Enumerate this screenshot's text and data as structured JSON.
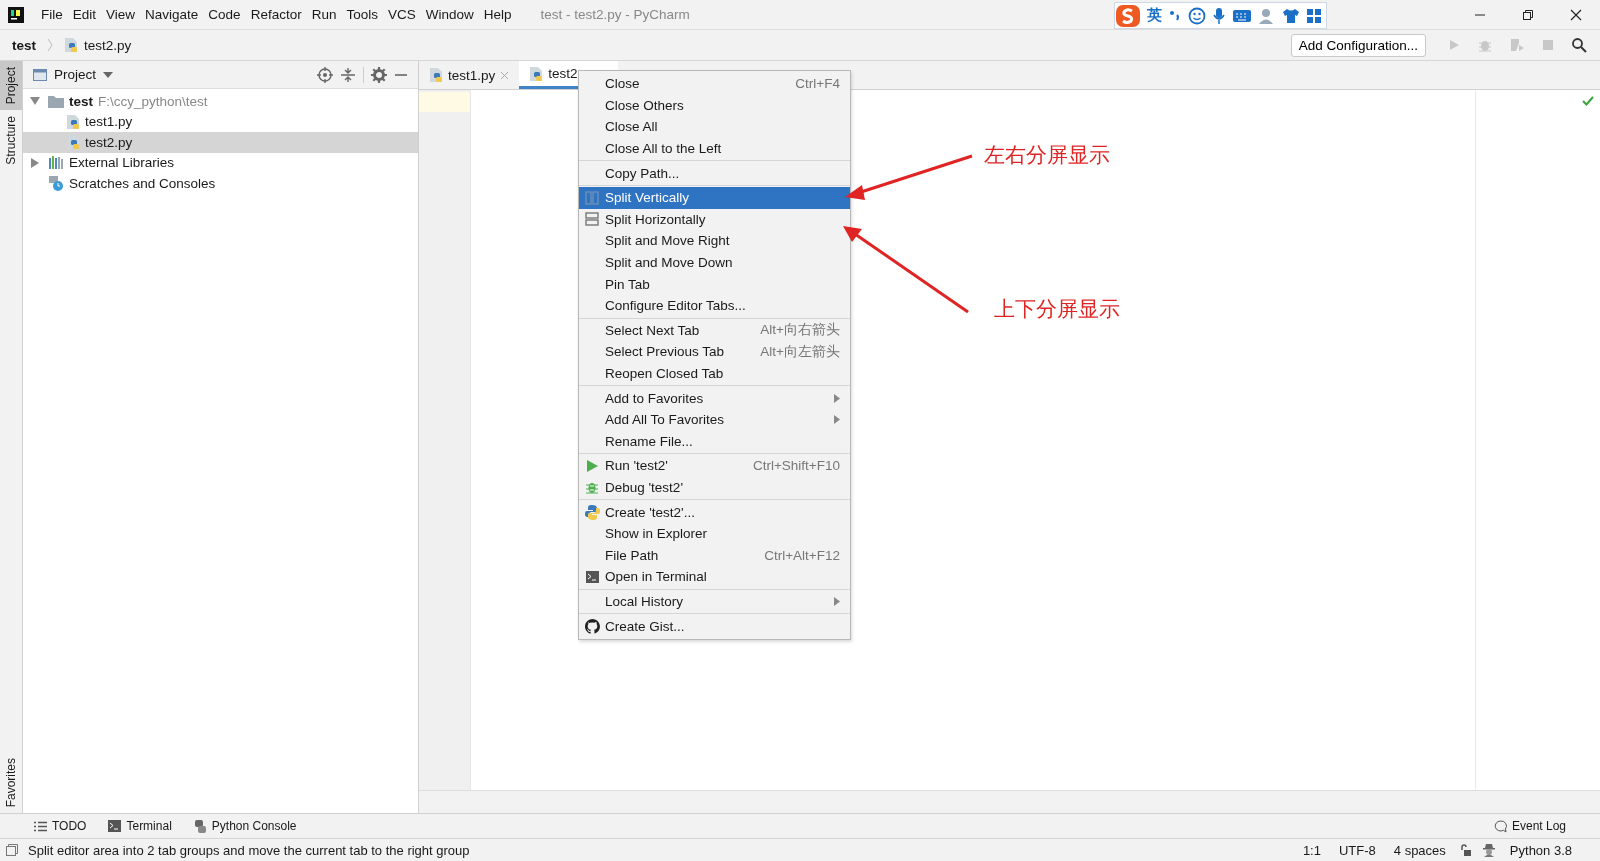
{
  "window": {
    "title": "test - test2.py - PyCharm"
  },
  "menu_bar": [
    "File",
    "Edit",
    "View",
    "Navigate",
    "Code",
    "Refactor",
    "Run",
    "Tools",
    "VCS",
    "Window",
    "Help"
  ],
  "ime_toolbar": {
    "label": "英"
  },
  "breadcrumbs": [
    "test",
    "test2.py"
  ],
  "toolbar": {
    "run_config": "Add Configuration..."
  },
  "side_strip": {
    "top": [
      {
        "label": "Project",
        "selected": true
      },
      {
        "label": "Structure",
        "selected": false
      }
    ],
    "bottom": [
      {
        "label": "Favorites",
        "selected": false
      }
    ]
  },
  "project_panel": {
    "title": "Project",
    "tree": [
      {
        "label": "test",
        "path": "F:\\ccy_python\\test",
        "expanded": true,
        "selected": false,
        "children": [
          {
            "label": "test1.py",
            "selected": false
          },
          {
            "label": "test2.py",
            "selected": true
          }
        ]
      },
      {
        "label": "External Libraries",
        "expanded": false,
        "selected": false
      },
      {
        "label": "Scratches and Consoles",
        "selected": false
      }
    ]
  },
  "editor_tabs": [
    {
      "label": "test1.py",
      "selected": false
    },
    {
      "label": "test2",
      "selected": true
    }
  ],
  "context_menu": {
    "groups": [
      [
        {
          "label": "Close",
          "shortcut": "Ctrl+F4",
          "selected": false
        },
        {
          "label": "Close Others",
          "selected": false
        },
        {
          "label": "Close All",
          "selected": false
        },
        {
          "label": "Close All to the Left",
          "selected": false
        }
      ],
      [
        {
          "label": "Copy Path...",
          "selected": false
        }
      ],
      [
        {
          "label": "Split Vertically",
          "selected": true
        },
        {
          "label": "Split Horizontally",
          "selected": false
        },
        {
          "label": "Split and Move Right",
          "selected": false
        },
        {
          "label": "Split and Move Down",
          "selected": false
        },
        {
          "label": "Pin Tab",
          "selected": false
        },
        {
          "label": "Configure Editor Tabs...",
          "selected": false
        }
      ],
      [
        {
          "label": "Select Next Tab",
          "shortcut": "Alt+向右箭头",
          "selected": false
        },
        {
          "label": "Select Previous Tab",
          "shortcut": "Alt+向左箭头",
          "selected": false
        },
        {
          "label": "Reopen Closed Tab",
          "selected": false
        }
      ],
      [
        {
          "label": "Add to Favorites",
          "submenu": true,
          "selected": false
        },
        {
          "label": "Add All To Favorites",
          "submenu": true,
          "selected": false
        },
        {
          "label": "Rename File...",
          "selected": false
        }
      ],
      [
        {
          "label": "Run 'test2'",
          "shortcut": "Ctrl+Shift+F10",
          "selected": false
        },
        {
          "label": "Debug 'test2'",
          "selected": false
        }
      ],
      [
        {
          "label": "Create 'test2'...",
          "selected": false
        },
        {
          "label": "Show in Explorer",
          "selected": false
        },
        {
          "label": "File Path",
          "shortcut": "Ctrl+Alt+F12",
          "selected": false
        },
        {
          "label": "Open in Terminal",
          "selected": false
        }
      ],
      [
        {
          "label": "Local History",
          "submenu": true,
          "selected": false
        }
      ],
      [
        {
          "label": "Create Gist...",
          "selected": false
        }
      ]
    ]
  },
  "annotations": [
    {
      "text": "左右分屏显示"
    },
    {
      "text": "上下分屏显示"
    }
  ],
  "tool_windows": [
    "TODO",
    "Terminal",
    "Python Console"
  ],
  "event_log": "Event Log",
  "status_bar": {
    "message": "Split editor area into 2 tab groups and move the current tab to the right group",
    "position": "1:1",
    "encoding": "UTF-8",
    "indent": "4 spaces",
    "interpreter": "Python 3.8"
  }
}
